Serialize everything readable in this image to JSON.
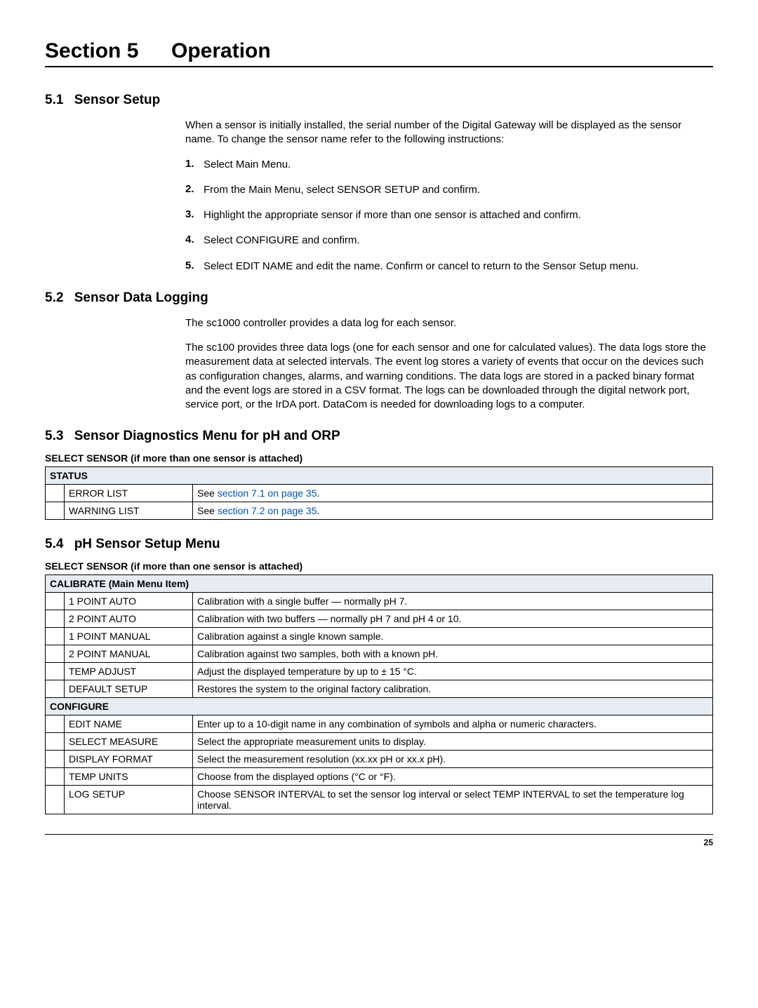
{
  "section_title_num": "Section 5",
  "section_title_text": "Operation",
  "s51": {
    "num": "5.1",
    "title": "Sensor Setup",
    "intro": "When a sensor is initially installed, the serial number of the Digital Gateway will be displayed as the sensor name. To change the sensor name refer to the following instructions:",
    "steps": [
      "Select Main Menu.",
      "From the Main Menu, select SENSOR SETUP and confirm.",
      "Highlight the appropriate sensor if more than one sensor is attached and confirm.",
      "Select CONFIGURE and confirm.",
      "Select EDIT NAME and edit the name. Confirm or cancel to return to the Sensor Setup menu."
    ]
  },
  "s52": {
    "num": "5.2",
    "title": "Sensor Data Logging",
    "p1": "The sc1000 controller provides a data log for each sensor.",
    "p2": "The sc100 provides three data logs (one for each sensor and one for calculated values). The data logs store the measurement data at selected intervals. The event log stores a variety of events that occur on the devices such as configuration changes, alarms, and warning conditions. The data logs are stored in a packed binary format and the event logs are stored in a CSV format. The logs can be downloaded through the digital network port, service port, or the IrDA port. DataCom is needed for downloading logs to a computer."
  },
  "s53": {
    "num": "5.3",
    "title": "Sensor Diagnostics Menu for pH and ORP",
    "caption": "SELECT SENSOR (if more than one sensor is attached)",
    "status_header": "STATUS",
    "rows": [
      {
        "name": "ERROR LIST",
        "pre": "See ",
        "link": "section 7.1 on page 35",
        "post": "."
      },
      {
        "name": "WARNING LIST",
        "pre": "See ",
        "link": "section 7.2 on page 35",
        "post": "."
      }
    ]
  },
  "s54": {
    "num": "5.4",
    "title": "pH Sensor Setup Menu",
    "caption": "SELECT SENSOR (if more than one sensor is attached)",
    "calibrate_header": "CALIBRATE (Main Menu Item)",
    "calibrate_rows": [
      {
        "name": "1 POINT AUTO",
        "desc": "Calibration with a single buffer — normally pH 7."
      },
      {
        "name": "2 POINT AUTO",
        "desc": "Calibration with two buffers — normally pH 7 and pH 4 or 10."
      },
      {
        "name": "1 POINT MANUAL",
        "desc": "Calibration against a single known sample."
      },
      {
        "name": "2 POINT MANUAL",
        "desc": "Calibration against two samples, both with a known pH."
      },
      {
        "name": "TEMP ADJUST",
        "desc": "Adjust the displayed temperature by up to ± 15 °C."
      },
      {
        "name": "DEFAULT SETUP",
        "desc": "Restores the system to the original factory calibration."
      }
    ],
    "configure_header": "CONFIGURE",
    "configure_rows": [
      {
        "name": "EDIT NAME",
        "desc": "Enter up to a 10-digit name in any combination of symbols and alpha or numeric characters."
      },
      {
        "name": "SELECT MEASURE",
        "desc": "Select the appropriate measurement units to display."
      },
      {
        "name": "DISPLAY FORMAT",
        "desc": "Select the measurement resolution (xx.xx pH or xx.x pH)."
      },
      {
        "name": "TEMP UNITS",
        "desc": "Choose from the displayed options (°C or °F)."
      },
      {
        "name": "LOG SETUP",
        "desc": "Choose SENSOR INTERVAL to set the sensor log interval or select TEMP INTERVAL to set the temperature log interval."
      }
    ]
  },
  "page_number": "25"
}
